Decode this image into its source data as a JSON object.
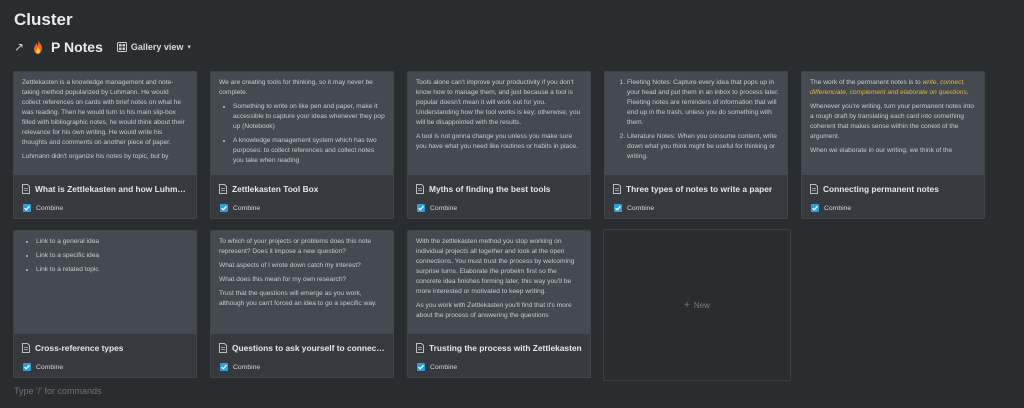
{
  "page": {
    "title": "Cluster"
  },
  "database": {
    "link_icon": "arrow-up-right-icon",
    "emoji_icon": "fire-icon",
    "title": "P Notes",
    "view_label": "Gallery view",
    "view_icon": "gallery-icon"
  },
  "property_label": "Combine",
  "cards": [
    {
      "title": "What is Zettlekasten and how Luhmann...",
      "combine": true,
      "preview": [
        {
          "type": "p",
          "text": "Zettlekasten is a knowledge management and note-taking method popularized by Luhmann. He would collect references on cards with brief notes on what he was reading. Then he would turn to his main slip-box filled with bibliographic notes, he would think about their relevance for his own writing. He would write his thoughts and comments on another piece of paper."
        },
        {
          "type": "p",
          "text": "Luhmann didn't organize his notes by topic, but by"
        }
      ]
    },
    {
      "title": "Zettlekasten Tool Box",
      "combine": true,
      "preview": [
        {
          "type": "p",
          "text": "We are creating tools for thinking, so it may never be complete."
        },
        {
          "type": "ul",
          "items": [
            "Something to write on like pen and paper, make it accessible to capture your ideas whenever they pop up (Notebook)",
            "A knowledge management system which has two purposes: to collect references and collect notes you take when reading"
          ]
        }
      ]
    },
    {
      "title": "Myths of finding the best tools",
      "combine": true,
      "preview": [
        {
          "type": "p",
          "text": "Tools alone can't improve your productivity if you don't know how to manage them, and just because a tool is popular doesn't mean it will work out for you. Understanding how the tool works is key; otherwise, you will be disappointed with the results."
        },
        {
          "type": "p",
          "text": "A tool is not gonna change you unless you make sure you have what you need like routines or habits in place."
        }
      ]
    },
    {
      "title": "Three types of notes to write a paper",
      "combine": true,
      "preview": [
        {
          "type": "ol",
          "items": [
            "Fleeting Notes: Capture every idea that pops up in your head and put them in an inbox to process later. Fleeting notes are reminders of information that will end up in the trash, unless you do something with them.",
            "Literature Notes: When you consume content, write down what you think might be useful for thinking or writing."
          ]
        }
      ]
    },
    {
      "title": "Connecting permanent notes",
      "combine": true,
      "preview": [
        {
          "type": "p_em",
          "text": "The work of the permanent notes is to ",
          "em": "write, connect, differenciate, complement and elaborate on questions."
        },
        {
          "type": "p",
          "text": "Whenever you're writing, turn your permanent notes into a rough draft by translating each card into something coherent that makes sense within the conext of the argument."
        },
        {
          "type": "p",
          "text": "When we elaborate in our writing, we think of the"
        }
      ]
    },
    {
      "title": "Cross-reference types",
      "combine": true,
      "preview": [
        {
          "type": "ul",
          "items": [
            "Link to a general idea",
            "Link to a specific idea",
            "Link to a related topic"
          ]
        }
      ]
    },
    {
      "title": "Questions to ask yourself to connect n...",
      "combine": true,
      "preview": [
        {
          "type": "p",
          "text": "To which of your projects or problems does this note represent? Does it impose a new question?"
        },
        {
          "type": "p",
          "text": "What aspects of I wrote down catch my interest?"
        },
        {
          "type": "p",
          "text": "What does this mean for my own research?"
        },
        {
          "type": "p",
          "text": "Trust that the questions will emerge as you work, although you can't forced an idea to go a specific way."
        }
      ]
    },
    {
      "title": "Trusting the process with Zettlekasten",
      "combine": true,
      "preview": [
        {
          "type": "p",
          "text": "With the zettlekasten method you stop working on individual projects all together and look at the open connections. You must trust the process by welcoming surprise turns. Elaborate the probelm first so the concrete idea finishes forming later, this way you'll be more interested or motivated to keep writing."
        },
        {
          "type": "p",
          "text": "As you work with Zettlekasten you'll find that it's more about the process of answering the questions"
        }
      ]
    }
  ],
  "new_card_label": "New",
  "command_hint": "Type '/' for commands"
}
